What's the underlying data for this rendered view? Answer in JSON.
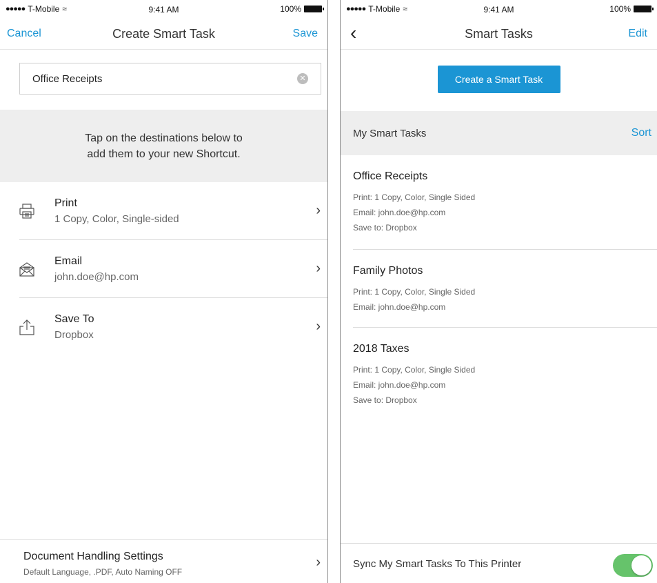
{
  "left": {
    "status": {
      "carrier": "T-Mobile",
      "time": "9:41 AM",
      "battery": "100%"
    },
    "nav": {
      "cancel": "Cancel",
      "title": "Create Smart Task",
      "save": "Save"
    },
    "name_field": {
      "value": "Office Receipts"
    },
    "hint": {
      "line1": "Tap on the destinations below to",
      "line2": "add them to your new Shortcut."
    },
    "destinations": [
      {
        "title": "Print",
        "sub": "1 Copy, Color, Single-sided",
        "icon": "printer-icon"
      },
      {
        "title": "Email",
        "sub": "john.doe@hp.com",
        "icon": "envelope-icon"
      },
      {
        "title": "Save To",
        "sub": "Dropbox",
        "icon": "share-upload-icon"
      }
    ],
    "doc_settings": {
      "title": "Document Handling Settings",
      "sub": "Default Language, .PDF, Auto Naming OFF"
    }
  },
  "right": {
    "status": {
      "carrier": "T-Mobile",
      "time": "9:41 AM",
      "battery": "100%"
    },
    "nav": {
      "title": "Smart Tasks",
      "edit": "Edit"
    },
    "create_button": "Create a Smart Task",
    "section": {
      "label": "My Smart Tasks",
      "sort": "Sort"
    },
    "tasks": [
      {
        "name": "Office Receipts",
        "lines": [
          "Print: 1 Copy, Color, Single Sided",
          "Email: john.doe@hp.com",
          "Save to: Dropbox"
        ]
      },
      {
        "name": "Family Photos",
        "lines": [
          "Print: 1 Copy, Color, Single Sided",
          "Email: john.doe@hp.com"
        ]
      },
      {
        "name": "2018 Taxes",
        "lines": [
          "Print: 1 Copy, Color, Single Sided",
          "Email: john.doe@hp.com",
          "Save to: Dropbox"
        ]
      }
    ],
    "sync": {
      "label": "Sync My Smart Tasks To This Printer",
      "enabled": true
    }
  },
  "colors": {
    "accent": "#1b95d4",
    "toggle_on": "#66c36b",
    "band": "#eeeeee"
  }
}
